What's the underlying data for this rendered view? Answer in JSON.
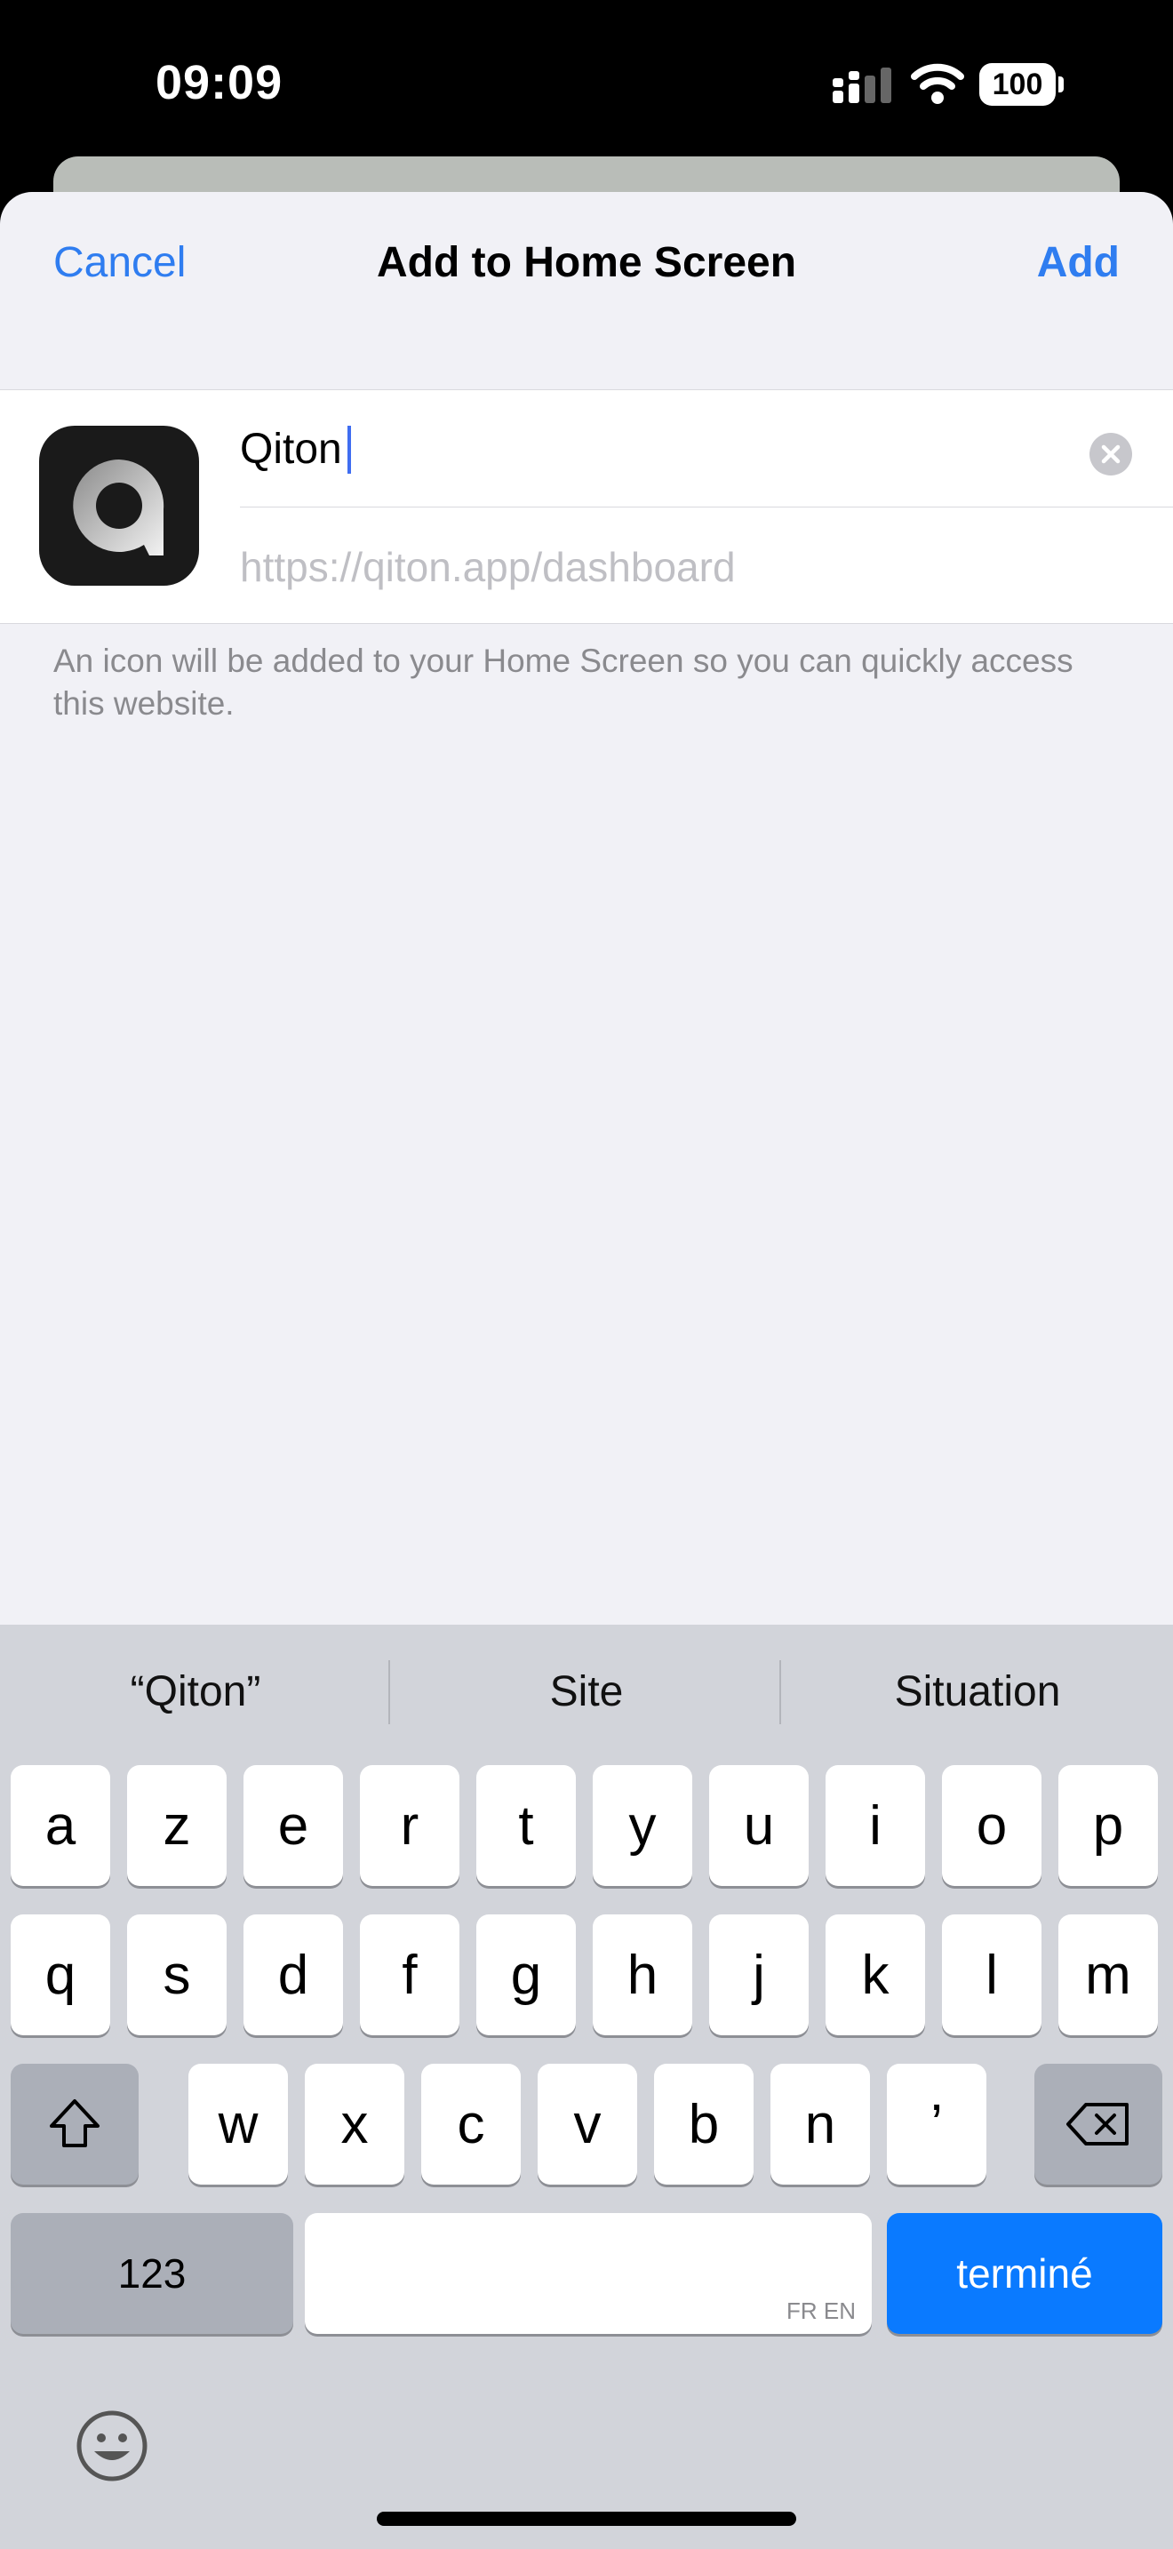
{
  "status_bar": {
    "time": "09:09",
    "battery": "100"
  },
  "nav": {
    "cancel": "Cancel",
    "title": "Add to Home Screen",
    "add": "Add"
  },
  "form": {
    "name_value": "Qiton",
    "url": "https://qiton.app/dashboard"
  },
  "hint": "An icon will be added to your Home Screen so you can quickly access this website.",
  "keyboard": {
    "suggestions": [
      "“Qiton”",
      "Site",
      "Situation"
    ],
    "row1": [
      "a",
      "z",
      "e",
      "r",
      "t",
      "y",
      "u",
      "i",
      "o",
      "p"
    ],
    "row2": [
      "q",
      "s",
      "d",
      "f",
      "g",
      "h",
      "j",
      "k",
      "l",
      "m"
    ],
    "row3": [
      "w",
      "x",
      "c",
      "v",
      "b",
      "n",
      "’"
    ],
    "numbers_label": "123",
    "space_lang": "FR EN",
    "done_label": "terminé"
  },
  "icons": [
    "signal-icon",
    "wifi-icon",
    "clear-icon",
    "shift-icon",
    "delete-icon",
    "emoji-icon",
    "app-logo-icon"
  ],
  "colors": {
    "accent": "#2f7df0",
    "done_key": "#0a7aff",
    "sheet_bg": "#f1f1f6"
  }
}
